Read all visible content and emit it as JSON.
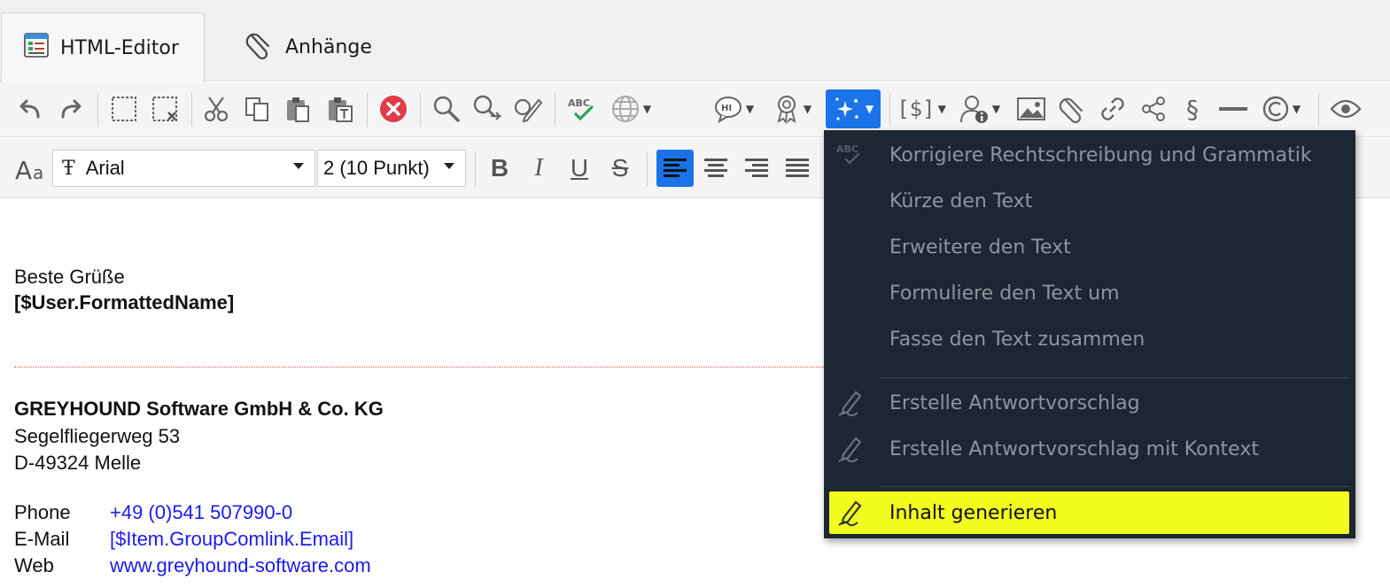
{
  "tabs": {
    "editor_label": "HTML-Editor",
    "attachments_label": "Anhänge"
  },
  "toolbar": {
    "icons": [
      "undo-icon",
      "redo-icon",
      "select-all-icon",
      "deselect-icon",
      "cut-icon",
      "copy-icon",
      "paste-icon",
      "paste-text-icon",
      "cancel-icon",
      "find-icon",
      "find-replace-icon",
      "edit-icon",
      "spellcheck-icon",
      "language-icon",
      "speech-bubble-icon",
      "award-icon",
      "ai-sparkle-icon",
      "variable-icon",
      "user-info-icon",
      "image-icon",
      "attachment-icon",
      "link-icon",
      "share-icon",
      "paragraph-icon",
      "horizontal-rule-icon",
      "copyright-icon",
      "preview-icon"
    ],
    "paragraph_symbol": "§",
    "variable_symbol": "[$]"
  },
  "format": {
    "font_value": "Arial",
    "size_value": "2 (10 Punkt)",
    "bold": "B",
    "italic": "I",
    "underline": "U",
    "strike": "S"
  },
  "colors": {
    "accent": "#1a73e8",
    "menu_bg": "#1d2733",
    "highlight": "#f2fc1d",
    "link_blue": "#1a1aee"
  },
  "editor": {
    "greeting": "Beste Grüße",
    "user_placeholder": "[$User.FormattedName]",
    "company": "GREYHOUND Software GmbH & Co. KG",
    "street": "Segelfliegerweg 53",
    "city": "D-49324 Melle",
    "contacts": [
      {
        "label": "Phone",
        "value": "+49 (0)541 507990-0"
      },
      {
        "label": "E-Mail",
        "value": "[$Item.GroupComlink.Email]"
      },
      {
        "label": "Web",
        "value": "www.greyhound-software.com"
      }
    ]
  },
  "menu": {
    "items": [
      {
        "label": "Korrigiere Rechtschreibung und Grammatik",
        "icon": "spellcheck-icon"
      },
      {
        "label": "Kürze den Text",
        "icon": ""
      },
      {
        "label": "Erweitere den Text",
        "icon": ""
      },
      {
        "label": "Formuliere den Text um",
        "icon": ""
      },
      {
        "label": "Fasse den Text zusammen",
        "icon": ""
      },
      {
        "label": "Erstelle Antwortvorschlag",
        "icon": "pen-icon"
      },
      {
        "label": "Erstelle Antwortvorschlag mit Kontext",
        "icon": "pen-icon"
      },
      {
        "label": "Inhalt generieren",
        "icon": "pen-icon"
      }
    ]
  }
}
